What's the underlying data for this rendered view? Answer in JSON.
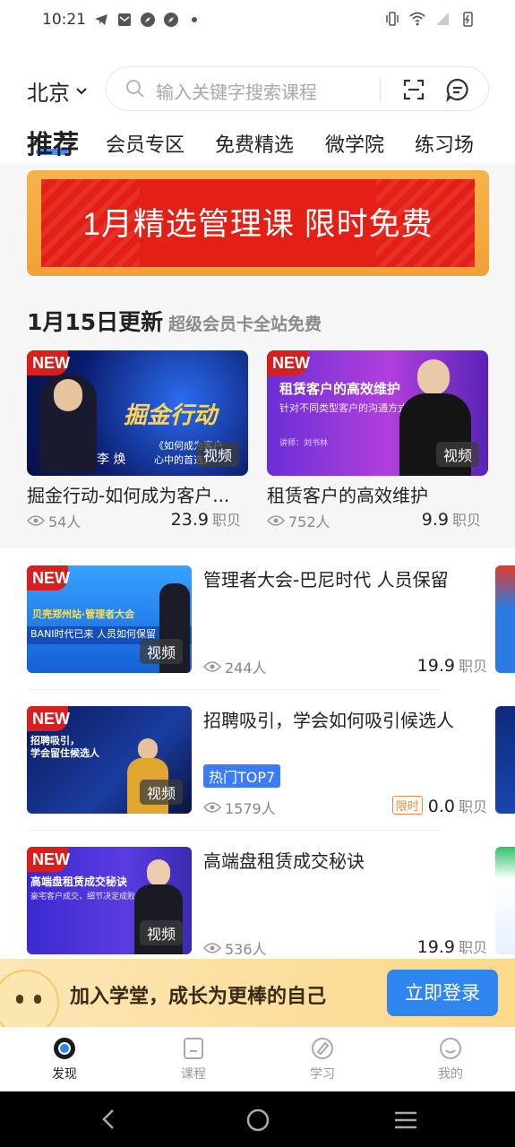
{
  "status_bar": {
    "time": "10:21"
  },
  "header": {
    "city": "北京",
    "search_placeholder": "输入关键字搜索课程"
  },
  "tabs": [
    {
      "label": "推荐"
    },
    {
      "label": "会员专区"
    },
    {
      "label": "免费精选"
    },
    {
      "label": "微学院"
    },
    {
      "label": "练习场"
    }
  ],
  "banner": {
    "text": "1月精选管理课 限时免费"
  },
  "section": {
    "title": "1月15日更新",
    "subtitle": "超级会员卡全站免费"
  },
  "badge_new": "NEW",
  "video_tag": "视频",
  "featured": [
    {
      "title": "掘金行动-如何成为客户...",
      "views": "54人",
      "price": "23.9",
      "unit": "职贝",
      "thumb_text": "掘金行动",
      "person_name": "李 焕",
      "thumb_sub": "《如何成为客户",
      "thumb_sub2": "心中的首选》"
    },
    {
      "title": "租赁客户的高效维护",
      "views": "752人",
      "price": "9.9",
      "unit": "职贝",
      "thumb_text": "租赁客户的高效维护",
      "thumb_sub": "针对不同类型客户的沟通方式",
      "speaker": "讲师：刘书林"
    }
  ],
  "list": [
    {
      "title": "管理者大会-巴尼时代 人员保留",
      "views": "244人",
      "price": "19.9",
      "unit": "职贝",
      "thumb_text": "贝壳郑州站·管理者大会",
      "thumb_text2": "BANI时代已来 人员如何保留"
    },
    {
      "title": "招聘吸引，学会如何吸引候选人",
      "views": "1579人",
      "price": "0.0",
      "unit": "职贝",
      "hot": "热门TOP7",
      "limit": "限时",
      "thumb_text": "招聘吸引，",
      "thumb_text2": "学会留住候选人"
    },
    {
      "title": "高端盘租赁成交秘诀",
      "views": "536人",
      "price": "19.9",
      "unit": "职贝",
      "thumb_text": "高端盘租赁成交秘诀",
      "thumb_text2": "豪宅客户成交，细节决定成败"
    }
  ],
  "join_bar": {
    "text": "加入学堂，成长为更棒的自己",
    "button": "立即登录"
  },
  "bottom_nav": [
    {
      "label": "发现",
      "icon": "discover-icon"
    },
    {
      "label": "课程",
      "icon": "course-icon"
    },
    {
      "label": "学习",
      "icon": "study-icon"
    },
    {
      "label": "我的",
      "icon": "profile-icon"
    }
  ],
  "colors": {
    "accent": "#2f86ee",
    "new_badge": "#d81e1e",
    "banner_red": "#e42016"
  }
}
